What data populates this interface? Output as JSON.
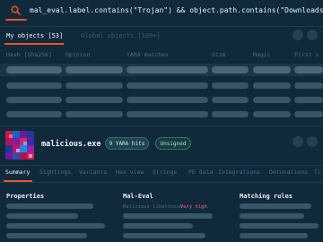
{
  "search": {
    "query": "mal_eval.label.contains(\"Trojan\") && object.path.contains(\"Downloads\")"
  },
  "object_tabs": [
    {
      "label": "My objects [53]",
      "active": true
    },
    {
      "label": "Global objects [100+]",
      "active": false
    }
  ],
  "table": {
    "columns": [
      "Hash [Sha256]",
      "Opinion",
      "YARA matches",
      "Size",
      "Magic",
      "First s"
    ]
  },
  "selected_object": {
    "file_name": "malicious.exe",
    "yara_badge": "9 YARA hits",
    "signature_badge": "Unsigned"
  },
  "detail_tabs": [
    "Summary",
    "Sightings",
    "Variants",
    "Hex view",
    "Strings",
    "PE data",
    "Integrations",
    "Detonations",
    "Ti"
  ],
  "sections": {
    "properties": "Properties",
    "mal_eval": "Mal-Eval",
    "matching_rules": "Matching rules"
  },
  "mal_eval": {
    "likelihood_label": "Malicious likelihood",
    "likelihood_value": "Very high"
  },
  "icons": {
    "search": "search-icon"
  },
  "colors": {
    "accent": "#e4572e",
    "background": "#102a3c",
    "danger": "#ff5d73",
    "success": "#9ce3c6"
  }
}
